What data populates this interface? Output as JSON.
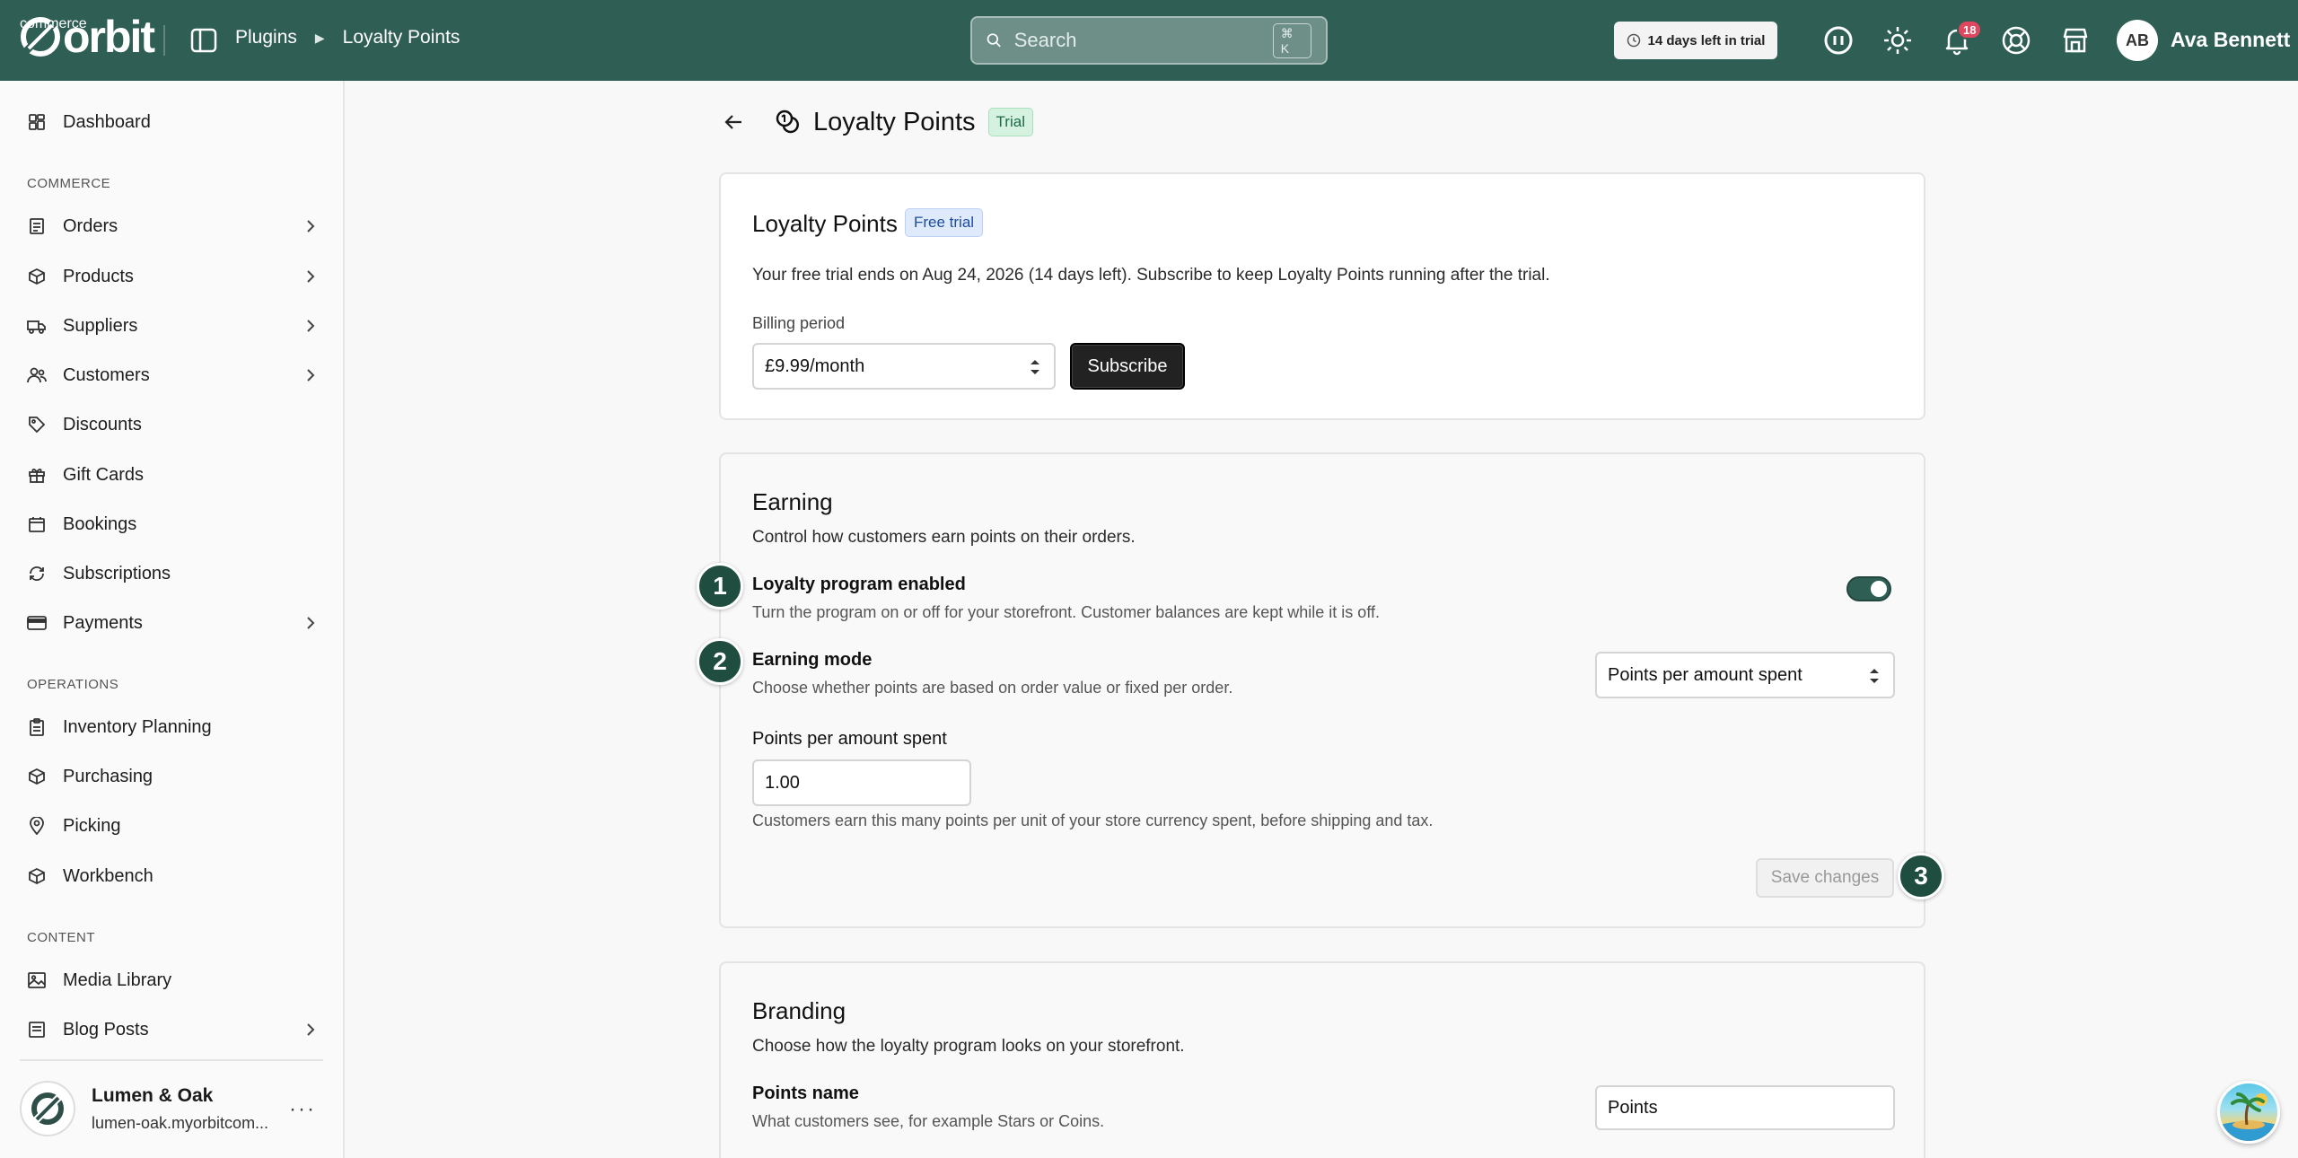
{
  "topbar": {
    "logo_word": "orbit",
    "logo_sub": "commerce",
    "breadcrumbs": [
      "Plugins",
      "Loyalty Points"
    ],
    "search_placeholder": "Search",
    "search_shortcut": "⌘ K",
    "trial_pill": "14 days left in trial",
    "notifications_count": "18",
    "avatar_initials": "AB",
    "user_name": "Ava Bennett"
  },
  "sidebar": {
    "dashboard": "Dashboard",
    "section_commerce": "COMMERCE",
    "commerce_items": [
      "Orders",
      "Products",
      "Suppliers",
      "Customers",
      "Discounts",
      "Gift Cards",
      "Bookings",
      "Subscriptions",
      "Payments"
    ],
    "section_operations": "OPERATIONS",
    "operations_items": [
      "Inventory Planning",
      "Purchasing",
      "Picking",
      "Workbench"
    ],
    "section_content": "CONTENT",
    "content_items": [
      "Media Library",
      "Blog Posts"
    ],
    "store_name": "Lumen & Oak",
    "store_url": "lumen-oak.myorbitcom..."
  },
  "page": {
    "title": "Loyalty Points",
    "badge": "Trial"
  },
  "subscription": {
    "title": "Loyalty Points",
    "badge": "Free trial",
    "text": "Your free trial ends on Aug 24, 2026 (14 days left). Subscribe to keep Loyalty Points running after the trial.",
    "billing_label": "Billing period",
    "billing_value": "£9.99/month",
    "subscribe_label": "Subscribe"
  },
  "earning": {
    "title": "Earning",
    "desc": "Control how customers earn points on their orders.",
    "enabled_title": "Loyalty program enabled",
    "enabled_desc": "Turn the program on or off for your storefront. Customer balances are kept while it is off.",
    "enabled": true,
    "mode_title": "Earning mode",
    "mode_desc": "Choose whether points are based on order value or fixed per order.",
    "mode_value": "Points per amount spent",
    "points_label": "Points per amount spent",
    "points_value": "1.00",
    "points_help": "Customers earn this many points per unit of your store currency spent, before shipping and tax.",
    "save_label": "Save changes"
  },
  "branding": {
    "title": "Branding",
    "desc": "Choose how the loyalty program looks on your storefront.",
    "points_name_title": "Points name",
    "points_name_desc": "What customers see, for example Stars or Coins.",
    "points_name_value": "Points"
  },
  "steps": [
    "1",
    "2",
    "3"
  ],
  "colors": {
    "brand": "#2e5e54",
    "step": "#1f4d3f",
    "badge_red": "#e0475f"
  }
}
